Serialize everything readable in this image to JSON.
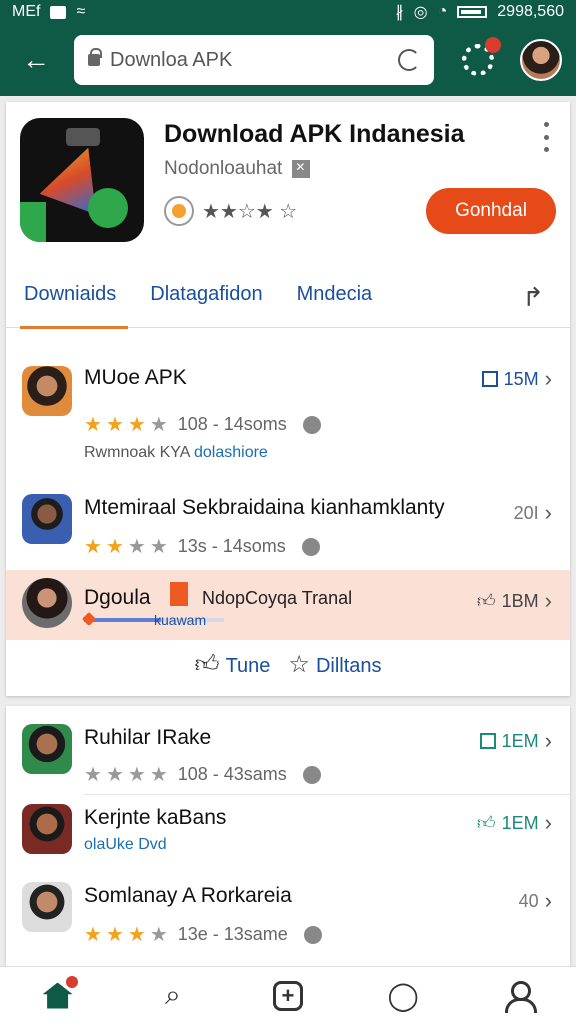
{
  "statusbar": {
    "carrier": "MEf",
    "time": "2998,560"
  },
  "search": {
    "value": "Downloa APK"
  },
  "app": {
    "title": "Download APK Indanesia",
    "developer": "Nodonloauhat",
    "rating_text": "★★☆★ ☆",
    "install_label": "Gonhdal"
  },
  "tabs": [
    {
      "label": "Downiaids"
    },
    {
      "label": "Dlatagafidon"
    },
    {
      "label": "Mndecia"
    }
  ],
  "list1": [
    {
      "name": "MUoe APK",
      "rating": "108 - 14soms",
      "sub_a": "Rwmnoak KYA",
      "sub_b": "dolashiore",
      "size": "15M"
    },
    {
      "name": "Mtemiraal  Sekbraidaina kianhamklanty",
      "rating": "13s - 14soms",
      "size": "20I"
    },
    {
      "name": "Dgoula",
      "extra": "NdopCoyqa Tranal",
      "progress_label": "kuawam",
      "progress": 0.55,
      "size": "1BM"
    }
  ],
  "actions": {
    "like": "Tune",
    "star": "Dilltans"
  },
  "list2": [
    {
      "name": "Ruhilar IRake",
      "rating": "108 - 43sams",
      "size": "1EM"
    },
    {
      "name": "Kerjnte kaBans",
      "sub": "olaUke  Dvd",
      "size": "1EM"
    },
    {
      "name": "Somlanay  A Rorkareia",
      "rating": "13e - 13same",
      "size": "40"
    }
  ],
  "colors": {
    "brand": "#0e5a47",
    "accent": "#e64a19",
    "link": "#1a4fa0",
    "highlight": "#fbe0d6"
  }
}
